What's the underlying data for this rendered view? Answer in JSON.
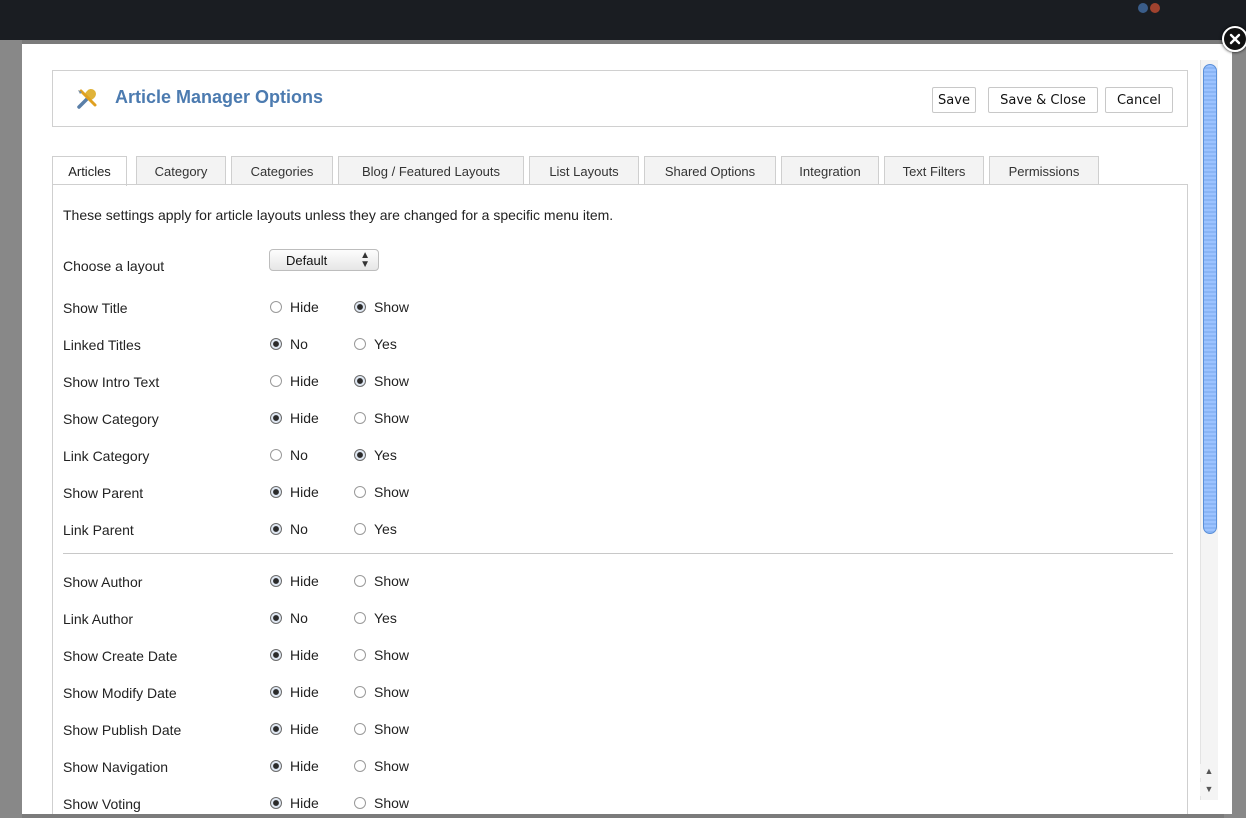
{
  "modal": {
    "title": "Article Manager Options",
    "actions": {
      "save": "Save",
      "save_close": "Save & Close",
      "cancel": "Cancel"
    }
  },
  "tabs": [
    "Articles",
    "Category",
    "Categories",
    "Blog / Featured Layouts",
    "List Layouts",
    "Shared Options",
    "Integration",
    "Text Filters",
    "Permissions"
  ],
  "active_tab": "Articles",
  "content": {
    "intro": "These settings apply for article layouts unless they are changed for a specific menu item.",
    "layout": {
      "label": "Choose a layout",
      "value": "Default"
    },
    "options": [
      {
        "label": "Show Title",
        "opts": [
          "Hide",
          "Show"
        ],
        "selected": 1
      },
      {
        "label": "Linked Titles",
        "opts": [
          "No",
          "Yes"
        ],
        "selected": 0
      },
      {
        "label": "Show Intro Text",
        "opts": [
          "Hide",
          "Show"
        ],
        "selected": 1
      },
      {
        "label": "Show Category",
        "opts": [
          "Hide",
          "Show"
        ],
        "selected": 0
      },
      {
        "label": "Link Category",
        "opts": [
          "No",
          "Yes"
        ],
        "selected": 1
      },
      {
        "label": "Show Parent",
        "opts": [
          "Hide",
          "Show"
        ],
        "selected": 0
      },
      {
        "label": "Link Parent",
        "opts": [
          "No",
          "Yes"
        ],
        "selected": 0
      },
      {
        "label": "Show Author",
        "opts": [
          "Hide",
          "Show"
        ],
        "selected": 0
      },
      {
        "label": "Link Author",
        "opts": [
          "No",
          "Yes"
        ],
        "selected": 0
      },
      {
        "label": "Show Create Date",
        "opts": [
          "Hide",
          "Show"
        ],
        "selected": 0
      },
      {
        "label": "Show Modify Date",
        "opts": [
          "Hide",
          "Show"
        ],
        "selected": 0
      },
      {
        "label": "Show Publish Date",
        "opts": [
          "Hide",
          "Show"
        ],
        "selected": 0
      },
      {
        "label": "Show Navigation",
        "opts": [
          "Hide",
          "Show"
        ],
        "selected": 0
      },
      {
        "label": "Show Voting",
        "opts": [
          "Hide",
          "Show"
        ],
        "selected": 0
      }
    ]
  },
  "icons": {
    "header": "tools-icon",
    "close": "close-icon",
    "select": "select-arrows-icon",
    "scroll_up": "arrow-up-icon",
    "scroll_down": "arrow-down-icon"
  },
  "colors": {
    "title": "#4c7bb0",
    "scroll_thumb": "#8ab5f5",
    "overlay": "#7b7b7b",
    "topbar": "#1a1d22"
  }
}
